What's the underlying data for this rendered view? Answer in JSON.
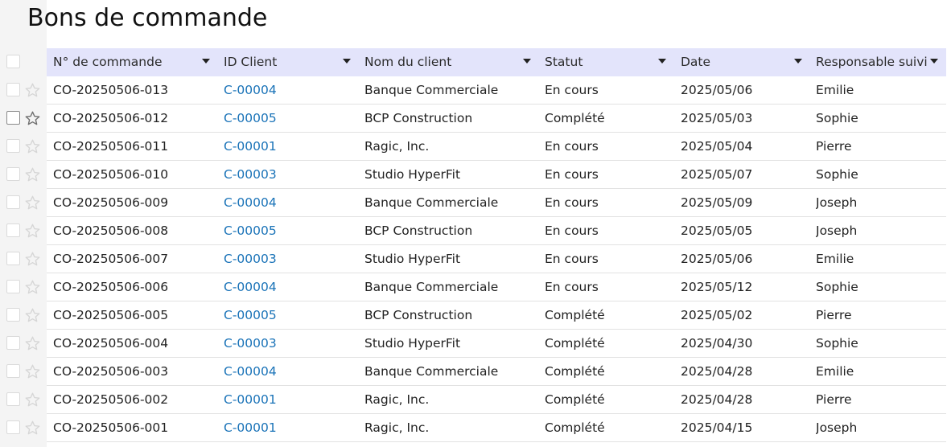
{
  "page": {
    "title": "Bons de commande"
  },
  "table": {
    "columns": [
      "N° de commande",
      "ID Client",
      "Nom du client",
      "Statut",
      "Date",
      "Responsable suivi"
    ],
    "rows": [
      [
        "CO-20250506-013",
        "C-00004",
        "Banque Commerciale",
        "En cours",
        "2025/05/06",
        "Emilie"
      ],
      [
        "CO-20250506-012",
        "C-00005",
        "BCP Construction",
        "Complété",
        "2025/05/03",
        "Sophie"
      ],
      [
        "CO-20250506-011",
        "C-00001",
        "Ragic, Inc.",
        "En cours",
        "2025/05/04",
        "Pierre"
      ],
      [
        "CO-20250506-010",
        "C-00003",
        "Studio HyperFit",
        "En cours",
        "2025/05/07",
        "Sophie"
      ],
      [
        "CO-20250506-009",
        "C-00004",
        "Banque Commerciale",
        "En cours",
        "2025/05/09",
        "Joseph"
      ],
      [
        "CO-20250506-008",
        "C-00005",
        "BCP Construction",
        "En cours",
        "2025/05/05",
        "Joseph"
      ],
      [
        "CO-20250506-007",
        "C-00003",
        "Studio HyperFit",
        "En cours",
        "2025/05/06",
        "Emilie"
      ],
      [
        "CO-20250506-006",
        "C-00004",
        "Banque Commerciale",
        "En cours",
        "2025/05/12",
        "Sophie"
      ],
      [
        "CO-20250506-005",
        "C-00005",
        "BCP Construction",
        "Complété",
        "2025/05/02",
        "Pierre"
      ],
      [
        "CO-20250506-004",
        "C-00003",
        "Studio HyperFit",
        "Complété",
        "2025/04/30",
        "Sophie"
      ],
      [
        "CO-20250506-003",
        "C-00004",
        "Banque Commerciale",
        "Complété",
        "2025/04/28",
        "Emilie"
      ],
      [
        "CO-20250506-002",
        "C-00001",
        "Ragic, Inc.",
        "Complété",
        "2025/04/28",
        "Pierre"
      ],
      [
        "CO-20250506-001",
        "C-00001",
        "Ragic, Inc.",
        "Complété",
        "2025/04/15",
        "Joseph"
      ]
    ],
    "hovered_row": 1
  },
  "colors": {
    "header_bg": "#e3e4fb",
    "link": "#1a73b8",
    "gutter": "#f4f4f4"
  },
  "icons": {
    "row_select": "checkbox-icon",
    "row_favorite": "star-icon",
    "column_menu": "caret-down-icon"
  }
}
